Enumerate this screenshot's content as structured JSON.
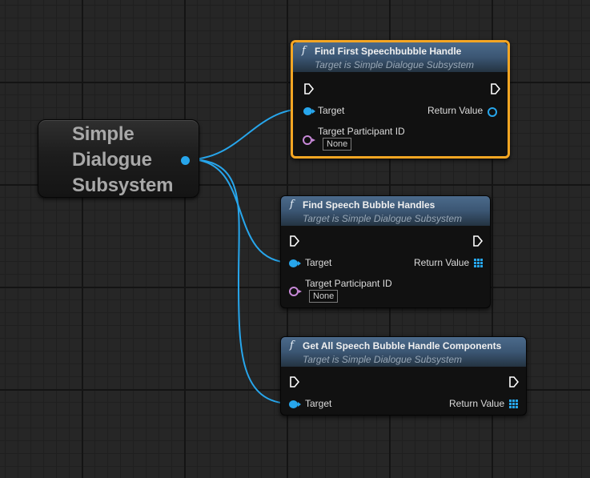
{
  "variable_node": {
    "name": "Simple\nDialogue\nSubsystem"
  },
  "nodes": [
    {
      "id": "find-first",
      "title": "Find First Speechbubble Handle",
      "subtitle": "Target is Simple Dialogue Subsystem",
      "selected": true,
      "inputs": [
        "Target",
        "Target Participant ID"
      ],
      "participant_default": "None",
      "output_label": "Return Value",
      "output_type": "object"
    },
    {
      "id": "find-handles",
      "title": "Find Speech Bubble Handles",
      "subtitle": "Target is Simple Dialogue Subsystem",
      "selected": false,
      "inputs": [
        "Target",
        "Target Participant ID"
      ],
      "participant_default": "None",
      "output_label": "Return Value",
      "output_type": "array"
    },
    {
      "id": "get-all",
      "title": "Get All Speech Bubble Handle Components",
      "subtitle": "Target is Simple Dialogue Subsystem",
      "selected": false,
      "inputs": [
        "Target"
      ],
      "output_label": "Return Value",
      "output_type": "array"
    }
  ],
  "colors": {
    "object_pin": "#27a6ec",
    "name_pin": "#c889d8",
    "selection": "#f5a623",
    "header": "#3b5673"
  },
  "icons": [
    "function-icon",
    "exec-pin-icon",
    "object-pin-icon",
    "name-pin-icon",
    "array-pin-icon"
  ]
}
